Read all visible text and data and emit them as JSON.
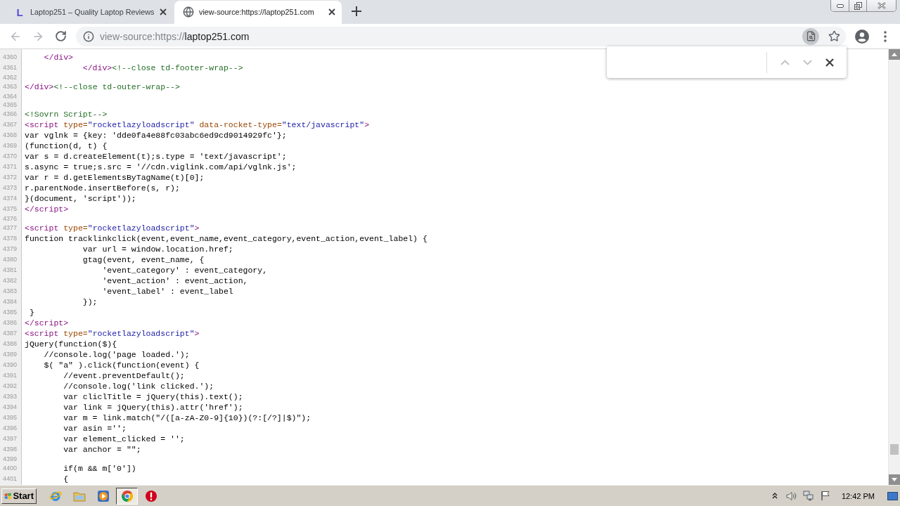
{
  "tabs": [
    {
      "kind": "letter",
      "favicon": "L",
      "title": "Laptop251 – Quality Laptop Reviews",
      "selected": false
    },
    {
      "kind": "globe",
      "title": "view-source:https://laptop251.com",
      "selected": true
    }
  ],
  "navigation": [
    {
      "kind": "back",
      "disabled": true
    },
    {
      "kind": "forward",
      "disabled": true
    },
    {
      "kind": "reload",
      "disabled": false
    }
  ],
  "address_bar": {
    "scheme": "view-source:https://",
    "host": "laptop251.com",
    "find_active": true
  },
  "find_bar": {
    "buttons": [
      {
        "kind": "previous",
        "disabled": true
      },
      {
        "kind": "next",
        "disabled": true
      },
      {
        "kind": "close",
        "disabled": false
      }
    ]
  },
  "source": {
    "lines": [
      {
        "number": "4360",
        "tokens": [
          {
            "kind": "tag",
            "text": "    </div>"
          }
        ]
      },
      {
        "number": "4361",
        "tokens": [
          {
            "kind": "tag",
            "text": "            </div>"
          },
          {
            "kind": "comment",
            "text": "<!--close td-footer-wrap-->"
          }
        ]
      },
      {
        "number": "4362"
      },
      {
        "number": "4363",
        "tokens": [
          {
            "kind": "tag",
            "text": "</div>"
          },
          {
            "kind": "comment",
            "text": "<!--close td-outer-wrap-->"
          }
        ]
      },
      {
        "number": "4364"
      },
      {
        "number": "4365"
      },
      {
        "number": "4366",
        "tokens": [
          {
            "kind": "comment",
            "text": "<!Sovrn Script-->"
          }
        ]
      },
      {
        "number": "4367",
        "tokens": [
          {
            "kind": "tag",
            "text": "<script "
          },
          {
            "kind": "attr",
            "text": "type="
          },
          {
            "kind": "value",
            "text": "\"rocketlazyloadscript\""
          },
          {
            "kind": "attr",
            "text": " data-rocket-type="
          },
          {
            "kind": "value",
            "text": "\"text/javascript\""
          },
          {
            "kind": "tag",
            "text": ">"
          }
        ]
      },
      {
        "number": "4368",
        "text": "var vglnk = {key: 'dde0fa4e88fc03abc6ed9cd9014929fc'};"
      },
      {
        "number": "4369",
        "text": "(function(d, t) {"
      },
      {
        "number": "4370",
        "text": "var s = d.createElement(t);s.type = 'text/javascript';"
      },
      {
        "number": "4371",
        "text": "s.async = true;s.src = '//cdn.viglink.com/api/vglnk.js';"
      },
      {
        "number": "4372",
        "text": "var r = d.getElementsByTagName(t)[0];"
      },
      {
        "number": "4373",
        "text": "r.parentNode.insertBefore(s, r);"
      },
      {
        "number": "4374",
        "text": "}(document, 'script'));"
      },
      {
        "number": "4375",
        "tokens": [
          {
            "kind": "tag",
            "text": "</script>"
          }
        ]
      },
      {
        "number": "4376"
      },
      {
        "number": "4377",
        "tokens": [
          {
            "kind": "tag",
            "text": "<script "
          },
          {
            "kind": "attr",
            "text": "type="
          },
          {
            "kind": "value",
            "text": "\"rocketlazyloadscript\""
          },
          {
            "kind": "tag",
            "text": ">"
          }
        ]
      },
      {
        "number": "4378",
        "text": "function tracklinkclick(event,event_name,event_category,event_action,event_label) {"
      },
      {
        "number": "4379",
        "text": "            var url = window.location.href;"
      },
      {
        "number": "4380",
        "text": "            gtag(event, event_name, {"
      },
      {
        "number": "4381",
        "text": "                'event_category' : event_category,"
      },
      {
        "number": "4382",
        "text": "                'event_action' : event_action,"
      },
      {
        "number": "4383",
        "text": "                'event_label' : event_label"
      },
      {
        "number": "4384",
        "text": "            });"
      },
      {
        "number": "4385",
        "text": " }"
      },
      {
        "number": "4386",
        "tokens": [
          {
            "kind": "tag",
            "text": "</script>"
          }
        ]
      },
      {
        "number": "4387",
        "tokens": [
          {
            "kind": "tag",
            "text": "<script "
          },
          {
            "kind": "attr",
            "text": "type="
          },
          {
            "kind": "value",
            "text": "\"rocketlazyloadscript\""
          },
          {
            "kind": "tag",
            "text": ">"
          }
        ]
      },
      {
        "number": "4388",
        "text": "jQuery(function($){"
      },
      {
        "number": "4389",
        "text": "    //console.log('page loaded.');"
      },
      {
        "number": "4390",
        "text": "    $( \"a\" ).click(function(event) {"
      },
      {
        "number": "4391",
        "text": "        //event.preventDefault();"
      },
      {
        "number": "4392",
        "text": "        //console.log('link clicked.');"
      },
      {
        "number": "4393",
        "text": "        var cliclTitle = jQuery(this).text();"
      },
      {
        "number": "4394",
        "text": "        var link = jQuery(this).attr('href');"
      },
      {
        "number": "4395",
        "text": "        var m = link.match(\"/([a-zA-Z0-9]{10})(?:[/?]|$)\");"
      },
      {
        "number": "4396",
        "text": "        var asin ='';"
      },
      {
        "number": "4397",
        "text": "        var element_clicked = '';"
      },
      {
        "number": "4398",
        "text": "        var anchor = \"\";"
      },
      {
        "number": "4399"
      },
      {
        "number": "4400",
        "text": "        if(m && m['0'])"
      },
      {
        "number": "4401",
        "text": "        {"
      }
    ]
  },
  "taskbar": {
    "start": "Start",
    "apps": [
      {
        "kind": "internet",
        "selected": false
      },
      {
        "kind": "folder",
        "selected": false
      },
      {
        "kind": "media",
        "selected": false
      },
      {
        "kind": "chrome",
        "selected": true
      },
      {
        "kind": "alert",
        "selected": false
      }
    ],
    "clock": "12:42 PM"
  }
}
